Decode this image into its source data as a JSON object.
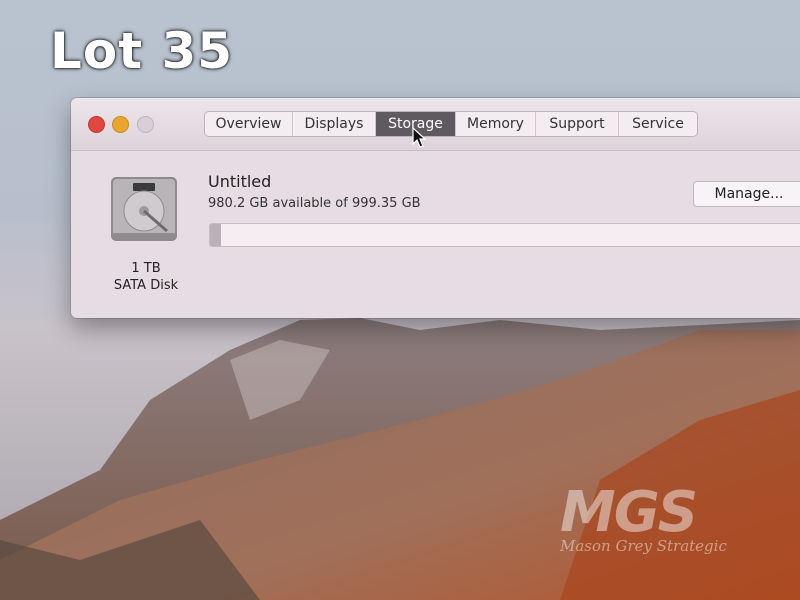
{
  "overlay": {
    "lot_label": "Lot 35"
  },
  "window": {
    "tabs": [
      {
        "label": "Overview",
        "active": false
      },
      {
        "label": "Displays",
        "active": false
      },
      {
        "label": "Storage",
        "active": true
      },
      {
        "label": "Memory",
        "active": false
      },
      {
        "label": "Support",
        "active": false
      },
      {
        "label": "Service",
        "active": false
      }
    ]
  },
  "storage": {
    "disk_capacity": "1 TB",
    "disk_type": "SATA Disk",
    "volume_name": "Untitled",
    "available_text": "980.2 GB available of 999.35 GB",
    "manage_label": "Manage...",
    "used_fraction": 0.019
  },
  "watermark": {
    "logo": "MGS",
    "subtitle": "Mason Grey Strategic"
  },
  "colors": {
    "close": "#e2463f",
    "minimize": "#e9a52d",
    "active_tab": "#5f5a60"
  },
  "icons": [
    "hard-disk-icon",
    "arrow-cursor-icon"
  ]
}
